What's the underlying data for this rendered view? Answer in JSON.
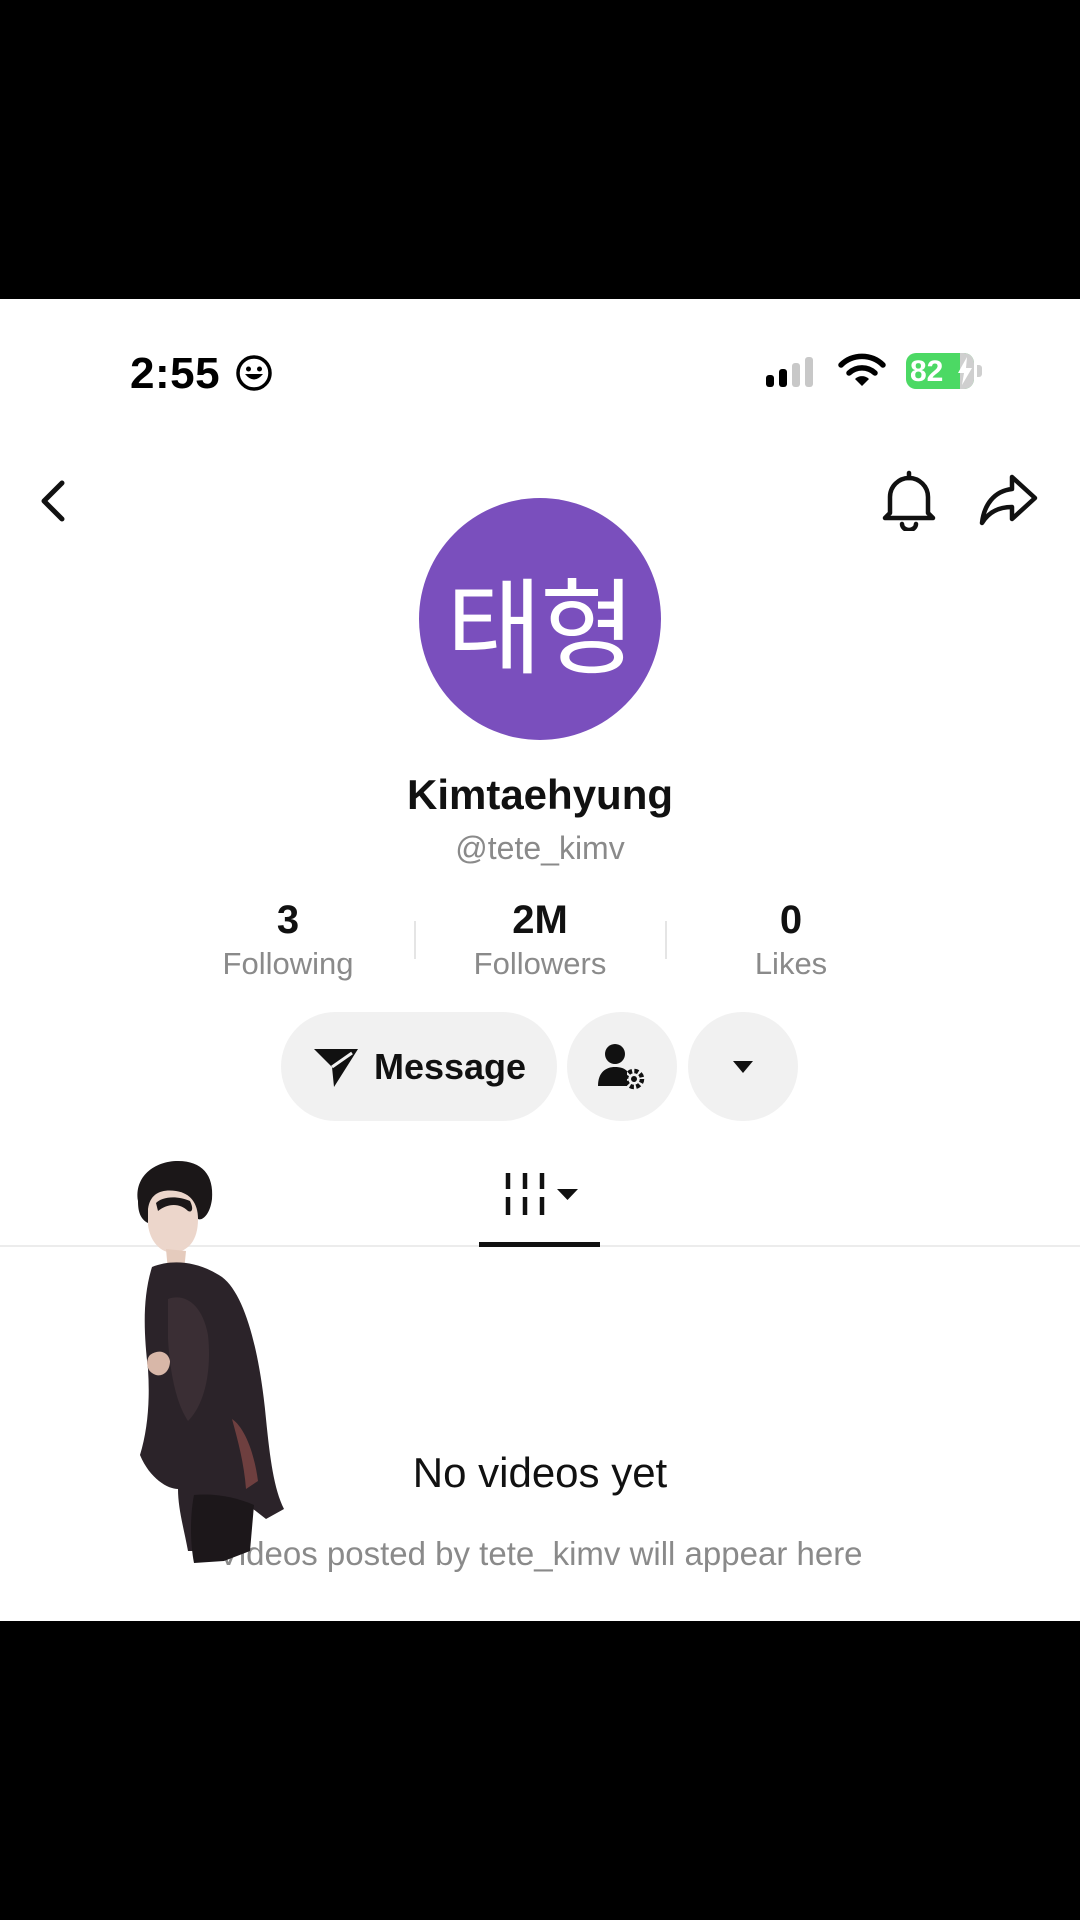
{
  "status_bar": {
    "time": "2:55",
    "battery": "82"
  },
  "header": {
    "back_icon": "chevron-left-icon",
    "bell_icon": "bell-icon",
    "share_icon": "share-arrow-icon"
  },
  "profile": {
    "avatar_text": "태형",
    "avatar_color": "#7a4fbd",
    "display_name": "Kimtaehyung",
    "handle": "@tete_kimv"
  },
  "stats": [
    {
      "value": "3",
      "label": "Following"
    },
    {
      "value": "2M",
      "label": "Followers"
    },
    {
      "value": "0",
      "label": "Likes"
    }
  ],
  "actions": {
    "message_label": "Message",
    "message_icon": "send-icon",
    "friend_settings_icon": "user-settings-icon",
    "more_icon": "caret-down-icon"
  },
  "tabs": {
    "active_icon": "videos-grid-icon"
  },
  "empty_state": {
    "title": "No videos yet",
    "subtitle": "Videos posted by tete_kimv will appear here"
  }
}
